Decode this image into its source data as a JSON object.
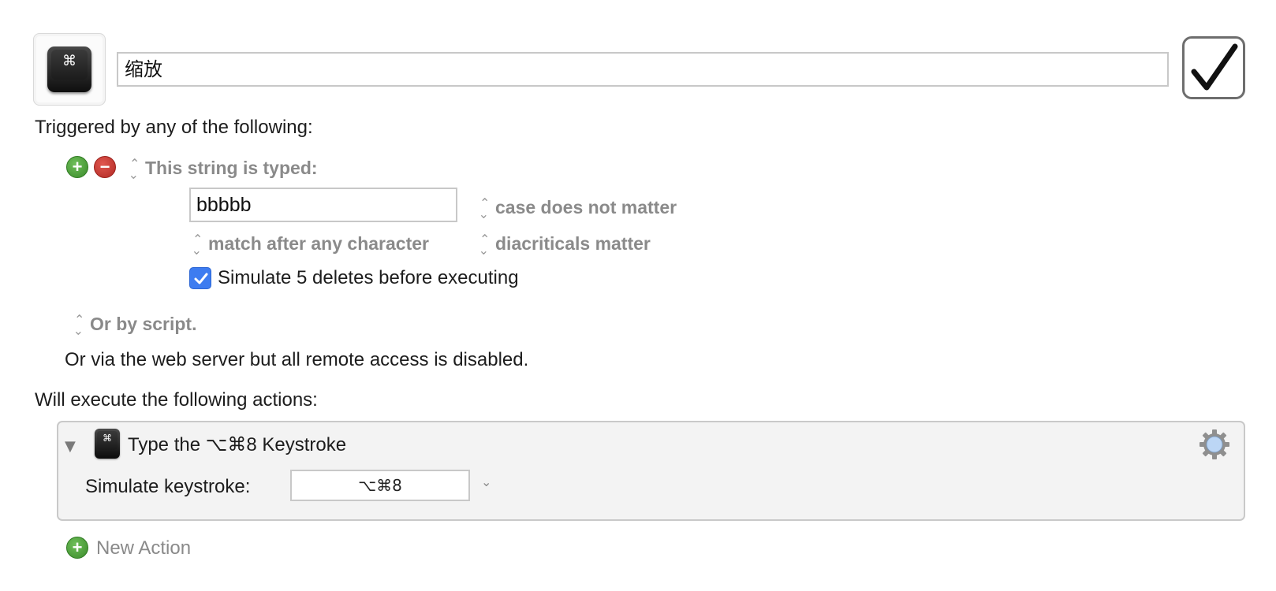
{
  "macro": {
    "name": "缩放",
    "icon_glyph": "⌘",
    "icon": "command-keycap-icon",
    "enabled": true
  },
  "triggers": {
    "heading": "Triggered by any of the following:",
    "add_symbol": "+",
    "remove_symbol": "−",
    "string_trigger": {
      "type_label": "This string is typed:",
      "value": "bbbbb",
      "case_option": "case does not matter",
      "match_option": "match after any character",
      "diacritics_option": "diacriticals matter",
      "simulate_deletes_checked": true,
      "simulate_deletes_label": "Simulate 5 deletes before executing"
    },
    "script_label": "Or by script.",
    "web_server_text": "Or via the web server but all remote access is disabled."
  },
  "actions": {
    "heading": "Will execute the following actions:",
    "items": [
      {
        "title": "Type the ⌥⌘8 Keystroke",
        "icon_glyph": "⌘",
        "field_label": "Simulate keystroke:",
        "keystroke": "⌥⌘8"
      }
    ],
    "new_action_label": "New Action"
  },
  "colors": {
    "accent_blue": "#3d7cf0",
    "add_green": "#3a8a2a",
    "remove_red": "#b12a24",
    "muted_gray": "#8a8a8a"
  }
}
